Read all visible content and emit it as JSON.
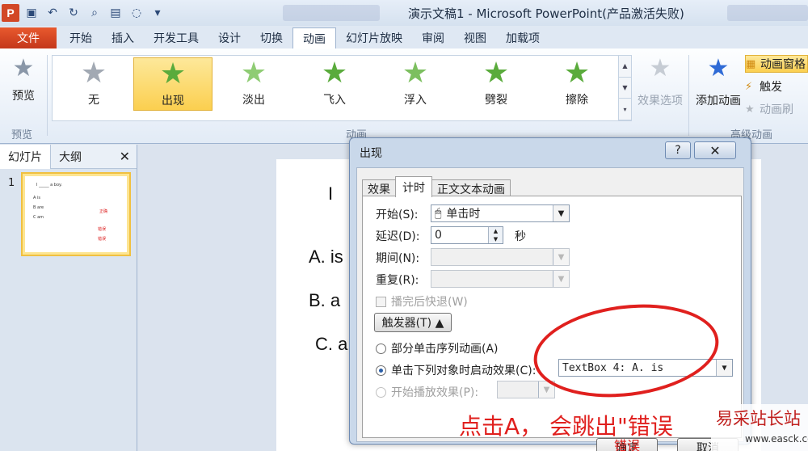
{
  "window": {
    "title": "演示文稿1 - Microsoft PowerPoint(产品激活失败)"
  },
  "tabs": [
    {
      "label": "文件"
    },
    {
      "label": "开始"
    },
    {
      "label": "插入"
    },
    {
      "label": "开发工具"
    },
    {
      "label": "设计"
    },
    {
      "label": "切换"
    },
    {
      "label": "动画"
    },
    {
      "label": "幻灯片放映"
    },
    {
      "label": "审阅"
    },
    {
      "label": "视图"
    },
    {
      "label": "加载项"
    }
  ],
  "ribbon": {
    "preview_label": "预览",
    "preview_group": "预览",
    "animation_group": "动画",
    "advanced_group": "高级动画",
    "gallery": [
      {
        "label": "无"
      },
      {
        "label": "出现"
      },
      {
        "label": "淡出"
      },
      {
        "label": "飞入"
      },
      {
        "label": "浮入"
      },
      {
        "label": "劈裂"
      },
      {
        "label": "擦除"
      }
    ],
    "effect_options": "效果选项",
    "add_animation": "添加动画",
    "animation_pane": "动画窗格",
    "trigger": "触发",
    "animation_painter": "动画刷"
  },
  "left_pane": {
    "tab_slides": "幻灯片",
    "tab_outline": "大纲",
    "close": "✕",
    "slide_number": "1",
    "thumb": {
      "line1": "I _____ a boy.",
      "a": "A   is",
      "b": "B   are",
      "c": "C   am",
      "mark1": "正确",
      "mark2": "错误",
      "mark3": "错误"
    }
  },
  "slide": {
    "line1": "I",
    "option_a": "A.  is",
    "option_b": "B.  a",
    "option_c": "C.  a"
  },
  "dialog": {
    "title": "出现",
    "help": "?",
    "close": "✕",
    "tabs": [
      {
        "label": "效果"
      },
      {
        "label": "计时"
      },
      {
        "label": "正文文本动画"
      }
    ],
    "start_label": "开始(S):",
    "start_value": "单击时",
    "delay_label": "延迟(D):",
    "delay_value": "0",
    "delay_unit": "秒",
    "duration_label": "期间(N):",
    "repeat_label": "重复(R):",
    "rewind_label": "播完后快退(W)",
    "trigger_button": "触发器(T) ▲",
    "radio_sequence": "部分单击序列动画(A)",
    "radio_click_object": "单击下列对象时启动效果(C):",
    "trigger_object_value": "TextBox 4: A.  is",
    "radio_play_effect": "开始播放效果(P):",
    "ok": "确定",
    "cancel": "取消"
  },
  "annotation": {
    "text": "点击A， 会跳出\"错误",
    "sub": "错误"
  },
  "watermark": {
    "text": "易采站长站",
    "url": "www.easck.com"
  },
  "colors": {
    "accent": "#d24726",
    "annotation": "#e0201e",
    "star_green": "#5aab3c"
  }
}
